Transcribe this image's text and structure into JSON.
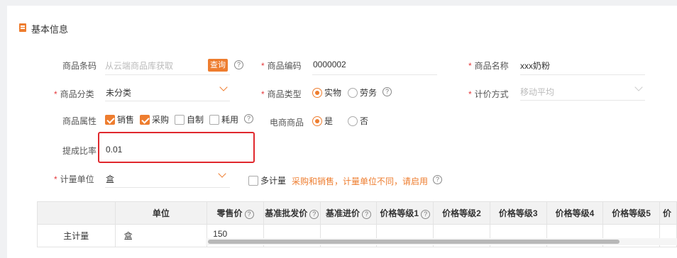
{
  "section": {
    "title": "基本信息"
  },
  "fields": {
    "barcode": {
      "label": "商品条码",
      "placeholder": "从云端商品库获取",
      "query_label": "查询"
    },
    "code": {
      "label": "商品编码",
      "value": "0000002"
    },
    "name": {
      "label": "商品名称",
      "value": "xxx奶粉"
    },
    "category": {
      "label": "商品分类",
      "value": "未分类"
    },
    "type": {
      "label": "商品类型",
      "options": [
        "实物",
        "劳务"
      ],
      "selected": "实物"
    },
    "pricing": {
      "label": "计价方式",
      "placeholder": "移动平均"
    },
    "attributes": {
      "label": "商品属性",
      "options": [
        "销售",
        "采购",
        "自制",
        "耗用"
      ],
      "checked": [
        "销售",
        "采购"
      ]
    },
    "ecommerce": {
      "label": "电商商品",
      "options": [
        "是",
        "否"
      ],
      "selected": "是"
    },
    "commission": {
      "label": "提成比率",
      "value": "0.01"
    },
    "unit": {
      "label": "计量单位",
      "value": "盒"
    },
    "multi_unit": {
      "label": "多计量",
      "note": "采购和销售，计量单位不同，请启用"
    }
  },
  "help_glyph": "?",
  "table": {
    "headers": [
      "",
      "单位",
      "零售价",
      "基准批发价",
      "基准进价",
      "价格等级1",
      "价格等级2",
      "价格等级3",
      "价格等级4",
      "价格等级5",
      "价"
    ],
    "rows": [
      [
        "主计量",
        "盒",
        "150",
        "",
        "",
        "",
        "",
        "",
        "",
        "",
        ""
      ]
    ]
  }
}
